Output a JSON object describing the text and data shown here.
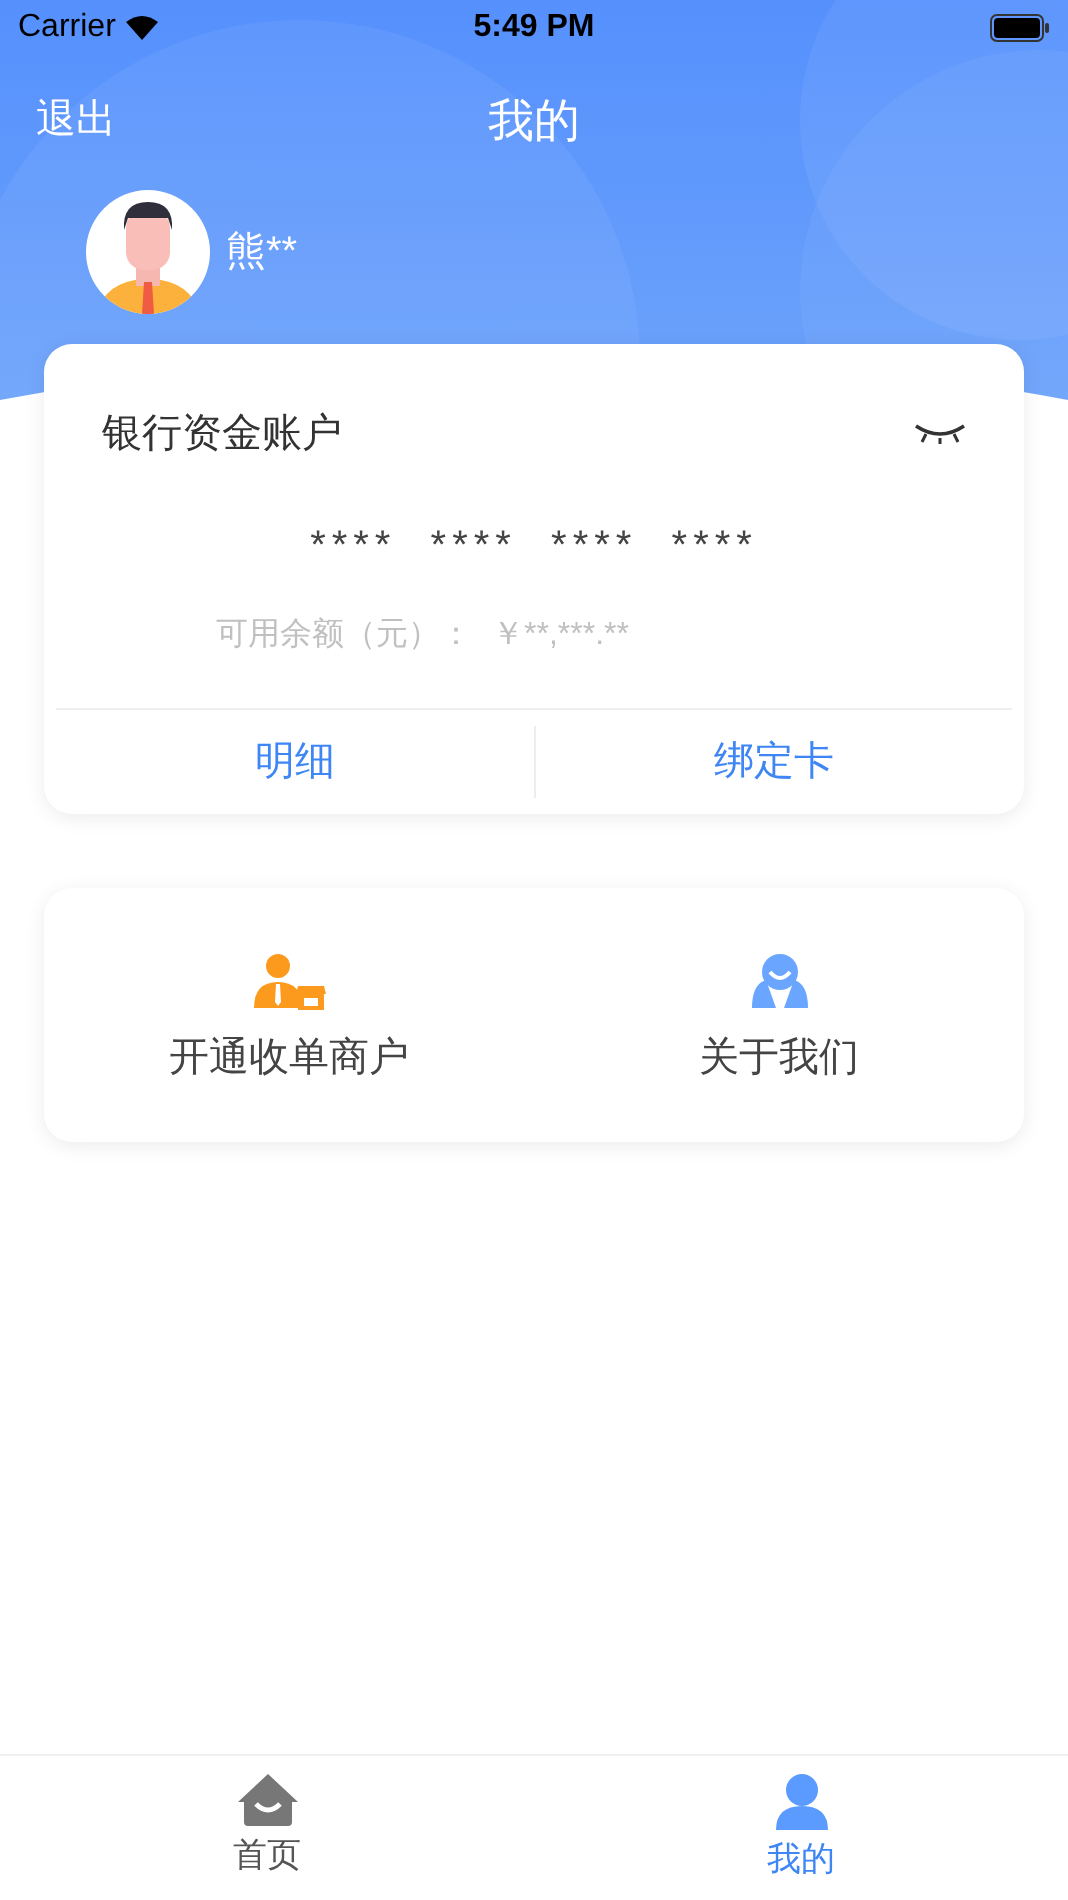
{
  "status_bar": {
    "carrier": "Carrier",
    "time": "5:49 PM"
  },
  "nav": {
    "back": "退出",
    "title": "我的"
  },
  "user": {
    "name": "熊**"
  },
  "account_card": {
    "title": "银行资金账户",
    "card_number": "****  ****  ****  ****",
    "balance_label": "可用余额（元）：",
    "balance_value": "￥**,***.**",
    "actions": [
      "明细",
      "绑定卡"
    ]
  },
  "services": [
    {
      "label": "开通收单商户",
      "kind": "merchant"
    },
    {
      "label": "关于我们",
      "kind": "about"
    }
  ],
  "tab_bar": [
    {
      "label": "首页",
      "kind": "home",
      "selected": false
    },
    {
      "label": "我的",
      "kind": "me",
      "selected": true
    }
  ]
}
